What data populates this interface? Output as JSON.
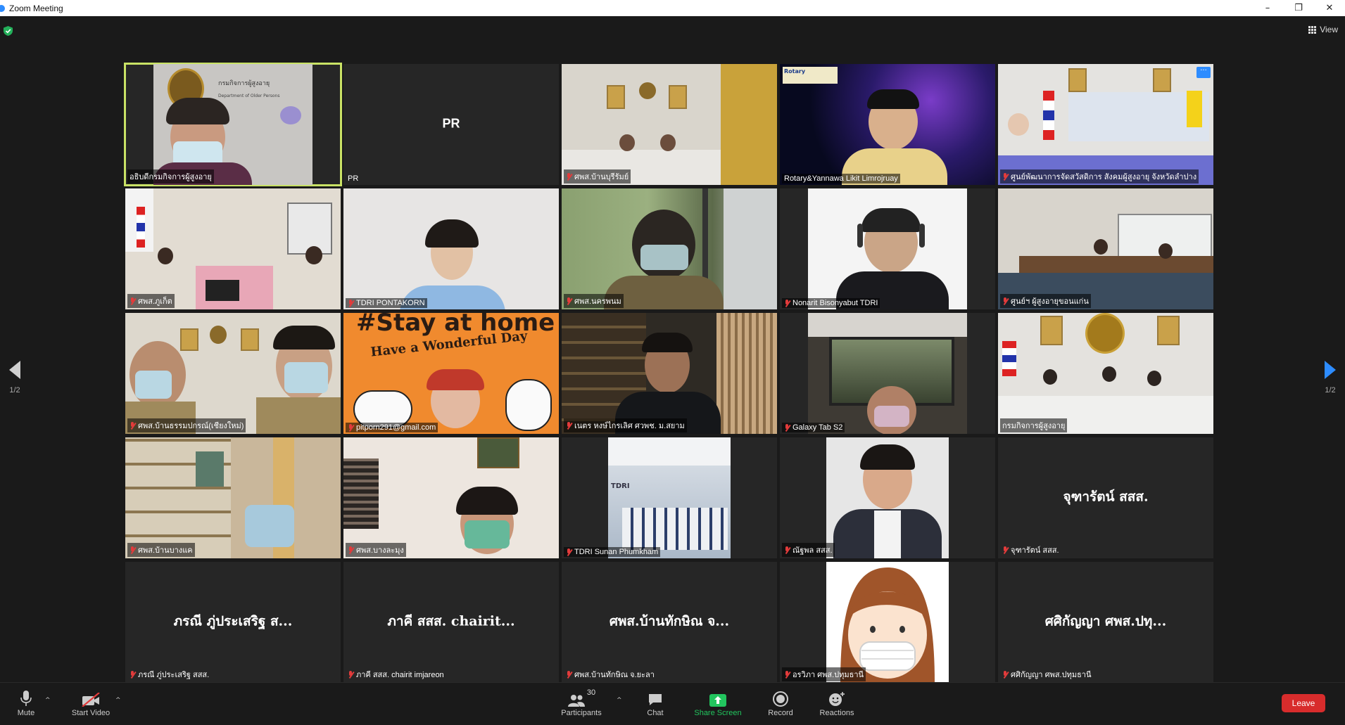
{
  "window": {
    "title": "Zoom Meeting",
    "minimize": "–",
    "maximize": "❐",
    "close": "✕"
  },
  "header": {
    "view_label": "View"
  },
  "pager": {
    "left_page": "1/2",
    "right_page": "1/2"
  },
  "tiles": [
    {
      "name": "อธิบดีกรมกิจการผู้สูงอายุ",
      "muted": false,
      "active": true
    },
    {
      "name": "PR",
      "muted": false,
      "big": "PR"
    },
    {
      "name": "ศพส.บ้านบุรีรัมย์",
      "muted": true
    },
    {
      "name": "Rotary&Yannawa Likit Limrojruay",
      "muted": false
    },
    {
      "name": "ศูนย์พัฒนาการจัดสวัสดิการ สังคมผู้สูงอายุ จังหวัดลำปาง",
      "muted": true,
      "more": "···"
    },
    {
      "name": "ศพส.ภูเก็ต",
      "muted": true
    },
    {
      "name": "TDRI PONTAKORN",
      "muted": true
    },
    {
      "name": "ศพส.นครพนม",
      "muted": true
    },
    {
      "name": "Nonarit Bisonyabut TDRI",
      "muted": true
    },
    {
      "name": "ศูนย์ฯ ผู้สูงอายุขอนแก่น",
      "muted": true
    },
    {
      "name": "ศพส.บ้านธรรมปกรณ์(เชียงใหม่)",
      "muted": true
    },
    {
      "name": "pitporn291@gmail.com",
      "muted": true
    },
    {
      "name": "เนตร หงษ์ไกรเลิศ ศวพช. ม.สยาม",
      "muted": true
    },
    {
      "name": "Galaxy Tab S2",
      "muted": true
    },
    {
      "name": "กรมกิจการผู้สูงอายุ",
      "muted": false
    },
    {
      "name": "ศพส.บ้านบางแค",
      "muted": true
    },
    {
      "name": "ศพส.บางละมุง",
      "muted": true
    },
    {
      "name": "TDRI Sunan Phumkham",
      "muted": true
    },
    {
      "name": "ณัฐพล สสส.",
      "muted": true
    },
    {
      "name": "จุฑารัตน์ สสส.",
      "muted": true,
      "big": "จุฑารัตน์ สสส."
    },
    {
      "name": "ภรณี ภู่ประเสริฐ สสส.",
      "muted": true,
      "big": "ภรณี ภู่ประเสริฐ ส..."
    },
    {
      "name": "ภาคี สสส. chairit imjareon",
      "muted": true,
      "big": "ภาคี สสส. chairit..."
    },
    {
      "name": "ศพส.บ้านทักษิณ จ.ยะลา",
      "muted": true,
      "big": "ศพส.บ้านทักษิณ จ..."
    },
    {
      "name": "อรวิภา ศพส.ปทุมธานี",
      "muted": true
    },
    {
      "name": "ศศิกัญญา ศพส.ปทุมธานี",
      "muted": true,
      "big": "ศศิกัญญา ศพส.ปทุ..."
    }
  ],
  "video_text": {
    "dept_sign_th": "กรมกิจการผู้สูงอายุ",
    "dept_sign_en": "Department of Older Persons",
    "rotary_logo": "Rotary",
    "stay_home_1": "#Stay at home",
    "stay_home_2": "Have a Wonderful Day",
    "tdri_logo": "TDRI"
  },
  "toolbar": {
    "mute": "Mute",
    "start_video": "Start Video",
    "participants": "Participants",
    "participants_count": "30",
    "chat": "Chat",
    "share_screen": "Share Screen",
    "record": "Record",
    "reactions": "Reactions",
    "leave": "Leave"
  },
  "colors": {
    "accent": "#2d8cff",
    "active_speaker": "#c9e265",
    "leave": "#d82c2c",
    "share": "#22c55e",
    "muted": "#e23b3b"
  }
}
